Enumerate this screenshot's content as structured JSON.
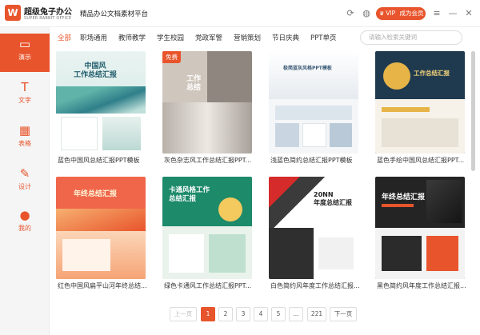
{
  "app": {
    "brand_name": "超级兔子办公",
    "brand_sub": "SUPER RABBIT OFFICE",
    "logo_letter": "W",
    "platform": "精品办公文档素材平台",
    "vip_label": "VIP",
    "vip_cta": "成为会员"
  },
  "sidebar": {
    "items": [
      {
        "label": "演示",
        "icon": "presentation-icon"
      },
      {
        "label": "文字",
        "icon": "text-doc-icon"
      },
      {
        "label": "表格",
        "icon": "table-icon"
      },
      {
        "label": "设计",
        "icon": "design-icon"
      },
      {
        "label": "我的",
        "icon": "user-icon"
      }
    ]
  },
  "categories": [
    "全部",
    "职场通用",
    "教师教学",
    "学生校园",
    "党政军警",
    "营销策划",
    "节日庆典",
    "PPT单页"
  ],
  "search": {
    "placeholder": "请输入检索关键词"
  },
  "templates": [
    {
      "title": "蓝色中国风总结汇报PPT模板",
      "thumb_heading": "中国风\n工作总结汇报",
      "free": false
    },
    {
      "title": "灰色杂志风工作总结汇报PPT...",
      "thumb_heading": "工作\n总结",
      "free": true,
      "badge": "免费"
    },
    {
      "title": "浅蓝色简约总结汇报PPT模板",
      "thumb_heading": "极简蓝灰风格PPT模板",
      "free": false
    },
    {
      "title": "蓝色手绘中国风总结汇报PPT...",
      "thumb_heading": "工作总结汇报",
      "free": false
    },
    {
      "title": "红色中国风扁平山河年终总结...",
      "thumb_heading": "年终总结汇报",
      "free": false
    },
    {
      "title": "绿色卡通风工作总结汇报PPT...",
      "thumb_heading": "卡通风格工作\n总结汇报",
      "free": false
    },
    {
      "title": "白色简约风年度工作总结汇报...",
      "thumb_heading": "20NN\n年度总结汇报",
      "free": false
    },
    {
      "title": "黑色简约风年度工作总结汇报...",
      "thumb_heading": "年终总结汇报",
      "free": false
    }
  ],
  "pagination": {
    "prev": "上一页",
    "pages": [
      "1",
      "2",
      "3",
      "4",
      "5",
      "...",
      "221"
    ],
    "next": "下一页",
    "current": "1"
  },
  "colors": {
    "accent": "#e8542c",
    "sidebar_bg": "#f5f5f5"
  }
}
